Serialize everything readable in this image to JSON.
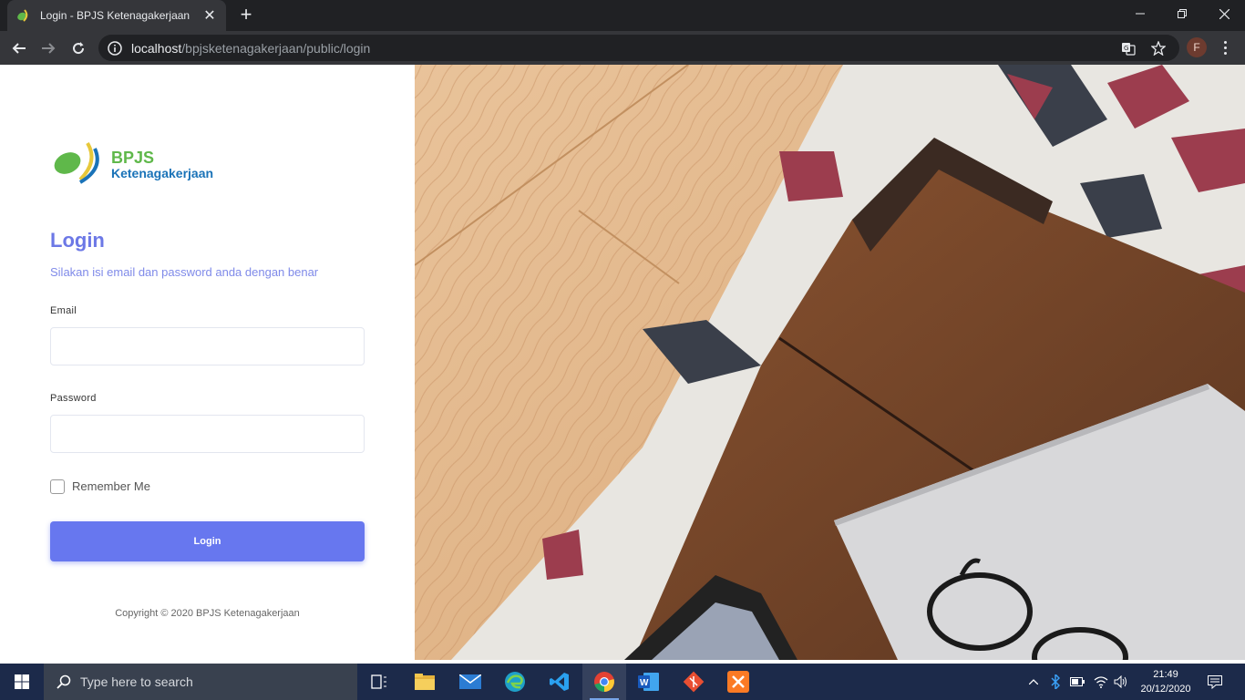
{
  "browser": {
    "tab_title": "Login - BPJS Ketenagakerjaan",
    "url_host": "localhost",
    "url_path": "/bpjsketenagakerjaan/public/login",
    "profile_initial": "F"
  },
  "login": {
    "logo_line1": "BPJS",
    "logo_line2": "Ketenagakerjaan",
    "heading": "Login",
    "subtitle": "Silakan isi email dan password anda dengan benar",
    "email_label": "Email",
    "email_value": "",
    "password_label": "Password",
    "password_value": "",
    "remember_label": "Remember Me",
    "remember_checked": false,
    "submit_label": "Login",
    "copyright": "Copyright © 2020 BPJS Ketenagakerjaan"
  },
  "taskbar": {
    "search_placeholder": "Type here to search",
    "time": "21:49",
    "date": "20/12/2020"
  },
  "colors": {
    "accent": "#6777ef",
    "heading": "#6c78e6",
    "browser_bg": "#202124",
    "taskbar_bg": "#1c2a4a"
  }
}
